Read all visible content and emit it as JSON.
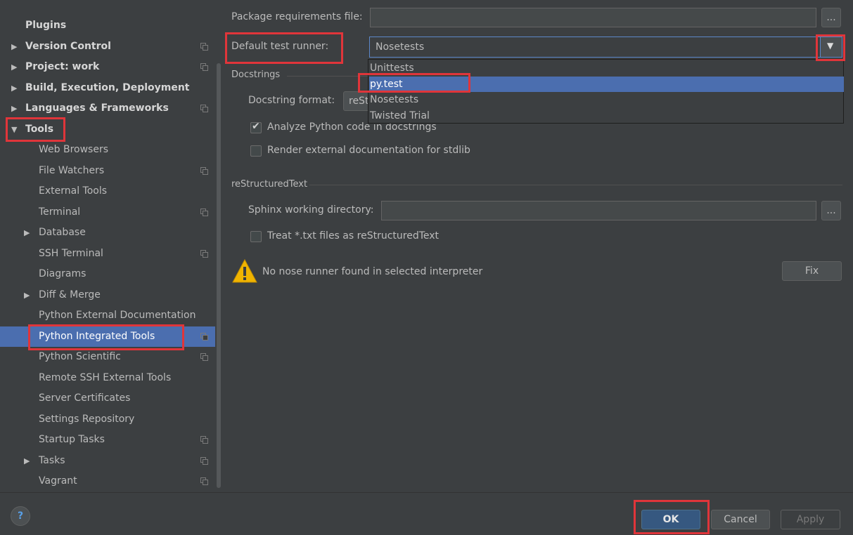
{
  "sidebar": {
    "items": [
      {
        "label": "Plugins",
        "arrow": "",
        "level": 0,
        "bold": true,
        "icon": false
      },
      {
        "label": "Version Control",
        "arrow": "▶",
        "level": 0,
        "bold": true,
        "icon": true
      },
      {
        "label": "Project: work",
        "arrow": "▶",
        "level": 0,
        "bold": true,
        "icon": true
      },
      {
        "label": "Build, Execution, Deployment",
        "arrow": "▶",
        "level": 0,
        "bold": true,
        "icon": false
      },
      {
        "label": "Languages & Frameworks",
        "arrow": "▶",
        "level": 0,
        "bold": true,
        "icon": true
      },
      {
        "label": "Tools",
        "arrow": "▼",
        "level": 0,
        "bold": true,
        "icon": false
      },
      {
        "label": "Web Browsers",
        "arrow": "",
        "level": 1,
        "bold": false,
        "icon": false
      },
      {
        "label": "File Watchers",
        "arrow": "",
        "level": 1,
        "bold": false,
        "icon": true
      },
      {
        "label": "External Tools",
        "arrow": "",
        "level": 1,
        "bold": false,
        "icon": false
      },
      {
        "label": "Terminal",
        "arrow": "",
        "level": 1,
        "bold": false,
        "icon": true
      },
      {
        "label": "Database",
        "arrow": "▶",
        "level": 1,
        "bold": false,
        "icon": false
      },
      {
        "label": "SSH Terminal",
        "arrow": "",
        "level": 1,
        "bold": false,
        "icon": true
      },
      {
        "label": "Diagrams",
        "arrow": "",
        "level": 1,
        "bold": false,
        "icon": false
      },
      {
        "label": "Diff & Merge",
        "arrow": "▶",
        "level": 1,
        "bold": false,
        "icon": false
      },
      {
        "label": "Python External Documentation",
        "arrow": "",
        "level": 1,
        "bold": false,
        "icon": false
      },
      {
        "label": "Python Integrated Tools",
        "arrow": "",
        "level": 1,
        "bold": false,
        "icon": true,
        "selected": true
      },
      {
        "label": "Python Scientific",
        "arrow": "",
        "level": 1,
        "bold": false,
        "icon": true
      },
      {
        "label": "Remote SSH External Tools",
        "arrow": "",
        "level": 1,
        "bold": false,
        "icon": false
      },
      {
        "label": "Server Certificates",
        "arrow": "",
        "level": 1,
        "bold": false,
        "icon": false
      },
      {
        "label": "Settings Repository",
        "arrow": "",
        "level": 1,
        "bold": false,
        "icon": false
      },
      {
        "label": "Startup Tasks",
        "arrow": "",
        "level": 1,
        "bold": false,
        "icon": true
      },
      {
        "label": "Tasks",
        "arrow": "▶",
        "level": 1,
        "bold": false,
        "icon": true
      },
      {
        "label": "Vagrant",
        "arrow": "",
        "level": 1,
        "bold": false,
        "icon": true
      }
    ]
  },
  "main": {
    "package_req_label": "Package requirements file:",
    "package_req_value": "",
    "browse_label": "...",
    "test_runner_label": "Default test runner:",
    "test_runner_value": "Nosetests",
    "test_runner_options": [
      "Unittests",
      "py.test",
      "Nosetests",
      "Twisted Trial"
    ],
    "test_runner_highlighted": "py.test",
    "docstrings_group": "Docstrings",
    "docstring_format_label": "Docstring format:",
    "docstring_format_value": "reSt",
    "analyze_label": "Analyze Python code in docstrings",
    "analyze_checked": true,
    "render_label": "Render external documentation for stdlib",
    "render_checked": false,
    "rst_group": "reStructuredText",
    "sphinx_label": "Sphinx working directory:",
    "sphinx_value": "",
    "treat_txt_label": "Treat *.txt files as reStructuredText",
    "treat_txt_checked": false,
    "warning_text": "No nose runner found in selected interpreter",
    "fix_label": "Fix"
  },
  "footer": {
    "help_label": "?",
    "ok_label": "OK",
    "cancel_label": "Cancel",
    "apply_label": "Apply"
  },
  "colors": {
    "background": "#3c3f41",
    "selection": "#4b6eaf",
    "annotation_red": "#e0353a",
    "warning_yellow": "#f0b400"
  }
}
